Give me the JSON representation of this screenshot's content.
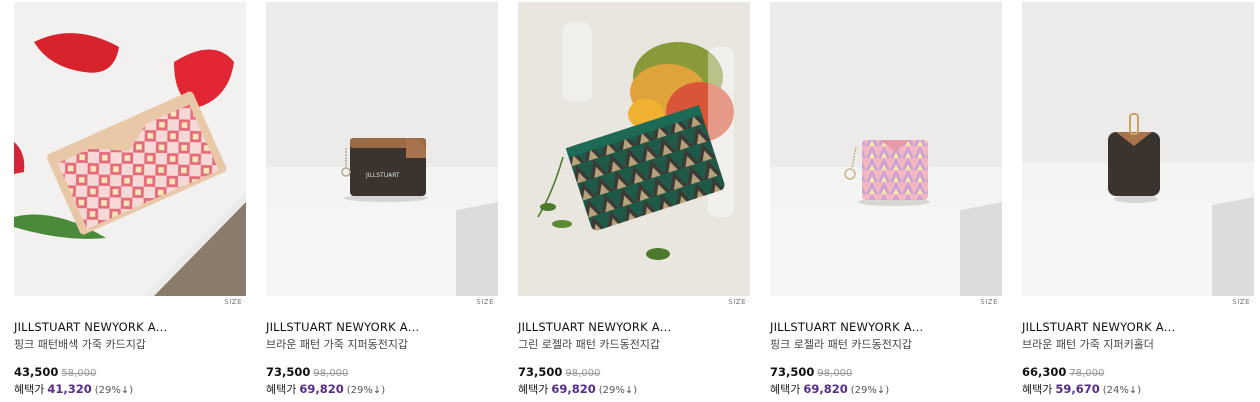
{
  "products": [
    {
      "brand": "JILLSTUART NEWYORK A…",
      "name": "핑크 패턴배색 가죽 카드지갑",
      "price": "43,500",
      "original_price": "58,000",
      "benefit_label": "혜택가",
      "benefit_price": "41,320",
      "benefit_pct": "(29%↓)",
      "size_tag": "SIZE",
      "image": "pink-card-wallet-with-petals"
    },
    {
      "brand": "JILLSTUART NEWYORK A…",
      "name": "브라운 패턴 가죽 지퍼동전지갑",
      "price": "73,500",
      "original_price": "98,000",
      "benefit_label": "혜택가",
      "benefit_price": "69,820",
      "benefit_pct": "(29%↓)",
      "size_tag": "SIZE",
      "image": "brown-zip-coin-wallet",
      "logo_text": "JILLSTUART"
    },
    {
      "brand": "JILLSTUART NEWYORK A…",
      "name": "그린 로젤라 패턴 카드동전지갑",
      "price": "73,500",
      "original_price": "98,000",
      "benefit_label": "혜택가",
      "benefit_price": "69,820",
      "benefit_pct": "(29%↓)",
      "size_tag": "SIZE",
      "image": "green-pouch-with-mangoes"
    },
    {
      "brand": "JILLSTUART NEWYORK A…",
      "name": "핑크 로젤라 패턴 카드동전지갑",
      "price": "73,500",
      "original_price": "98,000",
      "benefit_label": "혜택가",
      "benefit_price": "69,820",
      "benefit_pct": "(29%↓)",
      "size_tag": "SIZE",
      "image": "pink-card-coin-wallet"
    },
    {
      "brand": "JILLSTUART NEWYORK A…",
      "name": "브라운 패턴 가죽 지퍼키홀더",
      "price": "66,300",
      "original_price": "78,000",
      "benefit_label": "혜택가",
      "benefit_price": "59,670",
      "benefit_pct": "(24%↓)",
      "size_tag": "SIZE",
      "image": "brown-zip-key-holder"
    }
  ],
  "colors": {
    "benefit_price": "#5a2a8a",
    "original_price": "#999999"
  }
}
